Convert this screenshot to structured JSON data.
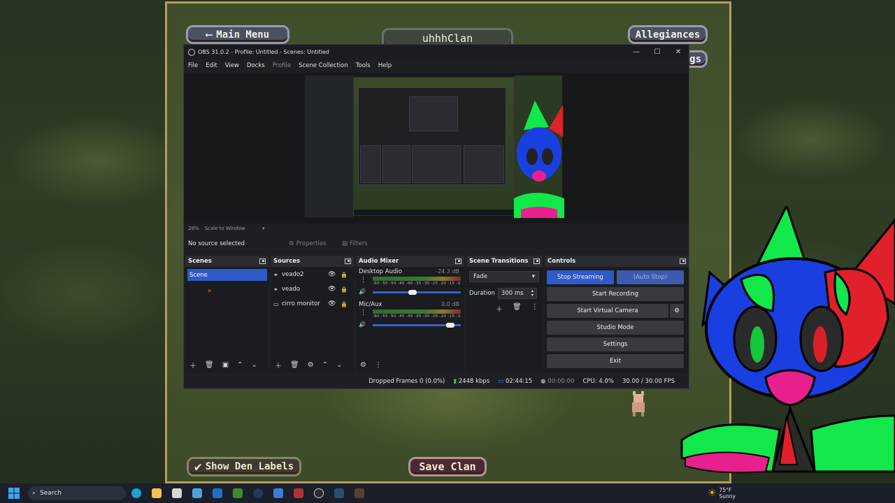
{
  "game": {
    "main_menu_label": "Main Menu",
    "clan_name": "uhhhClan",
    "allegiances_label": "Allegiances",
    "clipped_button_text": "gs",
    "show_den_labels_label": "Show Den Labels",
    "save_clan_label": "Save Clan"
  },
  "obs": {
    "window_title": "OBS 31.0.2 - Profile: Untitled - Scenes: Untitled",
    "menu": [
      "File",
      "Edit",
      "View",
      "Docks",
      "Profile",
      "Scene Collection",
      "Tools",
      "Help"
    ],
    "zoom_level": "28%",
    "scale_mode": "Scale to Window",
    "no_source_text": "No source selected",
    "properties_label": "Properties",
    "filters_label": "Filters",
    "scenes": {
      "title": "Scenes",
      "items": [
        "Scene"
      ]
    },
    "sources": {
      "title": "Sources",
      "items": [
        "veado2",
        "veado",
        "cirro monitor"
      ]
    },
    "audio_mixer": {
      "title": "Audio Mixer",
      "channels": [
        {
          "name": "Desktop Audio",
          "db": "-24.3 dB",
          "level": 0.45
        },
        {
          "name": "Mic/Aux",
          "db": "0.0 dB",
          "level": 0.92
        }
      ],
      "scale": "-60 -55 -50 -45 -40 -35 -30 -25 -20 -15 -10 -5 0"
    },
    "transitions": {
      "title": "Scene Transitions",
      "selected": "Fade",
      "duration_label": "Duration",
      "duration_value": "300 ms"
    },
    "controls": {
      "title": "Controls",
      "stop_streaming": "Stop Streaming",
      "auto_stop": "(Auto Stop)",
      "start_recording": "Start Recording",
      "start_virtual_camera": "Start Virtual Camera",
      "studio_mode": "Studio Mode",
      "settings": "Settings",
      "exit": "Exit"
    },
    "status": {
      "dropped_frames": "Dropped Frames 0 (0.0%)",
      "bitrate": "2448 kbps",
      "stream_time": "02:44:15",
      "record_time": "00:00:00",
      "cpu": "CPU: 4.0%",
      "fps": "30.00 / 30.00 FPS"
    }
  },
  "taskbar": {
    "search_placeholder": "Search",
    "weather_temp": "75°F",
    "weather_desc": "Sunny"
  },
  "colors": {
    "obs_accent": "#2f5bc8",
    "obs_bg": "#1e1f22",
    "mascot_blue": "#1a3fe0",
    "mascot_green": "#12e84a",
    "mascot_red": "#e0202a",
    "mascot_pink": "#e8208e"
  }
}
